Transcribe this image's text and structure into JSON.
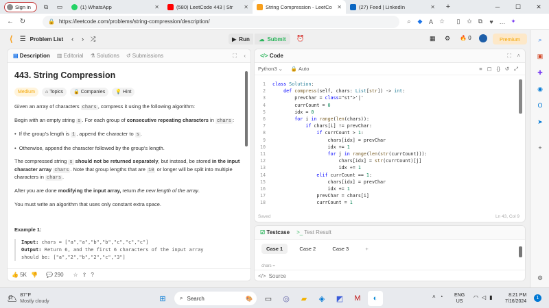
{
  "browser": {
    "signin": "Sign in",
    "tabs": [
      {
        "title": "(1) WhatsApp",
        "color": "#25d366"
      },
      {
        "title": "(580) LeetCode 443 | Str",
        "color": "#ff0000"
      },
      {
        "title": "String Compression - LeetCo",
        "color": "#f89f1b"
      },
      {
        "title": "(27) Feed | LinkedIn",
        "color": "#0a66c2"
      }
    ],
    "url": "https://leetcode.com/problems/string-compression/description/"
  },
  "lc": {
    "problem_list": "Problem List",
    "run": "Run",
    "submit": "Submit",
    "streak": "0",
    "premium": "Premium"
  },
  "desc_panel": {
    "tabs": [
      "Description",
      "Editorial",
      "Solutions",
      "Submissions"
    ],
    "title": "443. String Compression",
    "difficulty": "Medium",
    "topics": "Topics",
    "companies": "Companies",
    "hint": "Hint",
    "p1_pre": "Given an array of characters ",
    "p1_code": "chars",
    "p1_post": ", compress it using the following algorithm:",
    "p2_pre": "Begin with an empty string ",
    "p2_code": "s",
    "p2_mid": ". For each group of ",
    "p2_bold": "consecutive repeating characters",
    "p2_in": " in ",
    "p2_code2": "chars",
    "b1_pre": "If the group's length is ",
    "b1_code": "1",
    "b1_mid": ", append the character to ",
    "b1_code2": "s",
    "b2": "Otherwise, append the character followed by the group's length.",
    "p3_pre": "The compressed string ",
    "p3_code": "s",
    "p3_b1": " should not be returned separately",
    "p3_mid": ", but instead, be stored ",
    "p3_b2": "in the input character array",
    "p3_code2": "chars",
    "p3_post1": ". Note that group lengths that are ",
    "p3_code3": "10",
    "p3_post2": " or longer will be split into multiple characters in ",
    "p3_code4": "chars",
    "p4_pre": "After you are done ",
    "p4_b": "modifying the input array,",
    "p4_mid": " return ",
    "p4_i": "the new length of the array",
    "p5": "You must write an algorithm that uses only constant extra space.",
    "example": "Example 1:",
    "ex_input_l": "Input:",
    "ex_input": " chars = [\"a\",\"a\",\"b\",\"b\",\"c\",\"c\",\"c\"]",
    "ex_output_l": "Output:",
    "ex_output": " Return 6, and the first 6 characters of the input array",
    "ex_output2": "should be: [\"a\",\"2\",\"b\",\"2\",\"c\",\"3\"]",
    "likes": "5K",
    "comments": "290"
  },
  "code_panel": {
    "title": "Code",
    "lang": "Python3",
    "auto": "Auto",
    "saved": "Saved",
    "cursor": "Ln 43, Col 9",
    "lines": [
      {
        "n": "1",
        "code": "class Solution:"
      },
      {
        "n": "2",
        "code": "    def compress(self, chars: List[str]) -> int:"
      },
      {
        "n": "3",
        "code": "        prevChar = '|'"
      },
      {
        "n": "4",
        "code": "        currCount = 0"
      },
      {
        "n": "5",
        "code": "        idx = 0"
      },
      {
        "n": "6",
        "code": "        for i in range(len(chars)):"
      },
      {
        "n": "7",
        "code": "            if chars[i] != prevChar:"
      },
      {
        "n": "8",
        "code": "                if currCount > 1:"
      },
      {
        "n": "9",
        "code": "                    chars[idx] = prevChar"
      },
      {
        "n": "10",
        "code": "                    idx += 1"
      },
      {
        "n": "11",
        "code": "                    for j in range(len(str(currCount))):"
      },
      {
        "n": "12",
        "code": "                        chars[idx] = str(currCount)[j]"
      },
      {
        "n": "13",
        "code": "                        idx += 1"
      },
      {
        "n": "14",
        "code": "                elif currCount == 1:"
      },
      {
        "n": "15",
        "code": "                    chars[idx] = prevChar"
      },
      {
        "n": "16",
        "code": "                    idx += 1"
      },
      {
        "n": "17",
        "code": "                prevChar = chars[i]"
      },
      {
        "n": "18",
        "code": "                currCount = 1"
      },
      {
        "n": "19",
        "code": "            else:"
      }
    ]
  },
  "test_panel": {
    "testcase": "Testcase",
    "result": "Test Result",
    "cases": [
      "Case 1",
      "Case 2",
      "Case 3"
    ],
    "add": "+",
    "chars_label": "chars =",
    "source": "Source"
  },
  "taskbar": {
    "temp": "87°F",
    "weather": "Mostly cloudy",
    "search": "Search",
    "lang1": "ENG",
    "lang2": "US",
    "time": "8:21 PM",
    "date": "7/16/2024"
  }
}
